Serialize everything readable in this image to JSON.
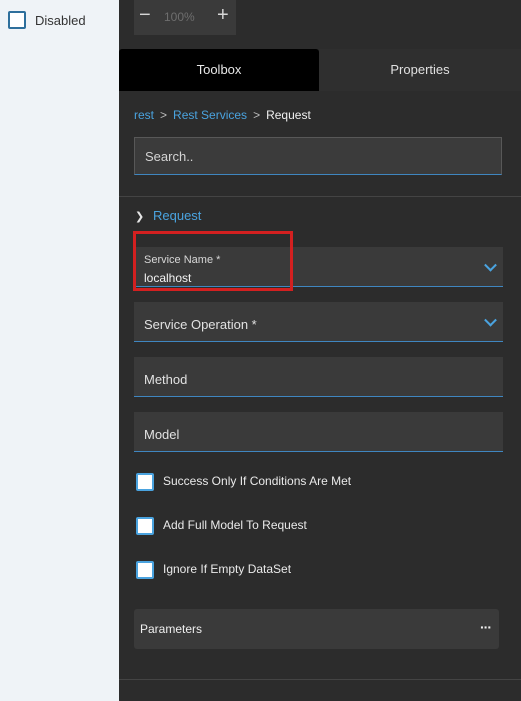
{
  "left_pane": {
    "disabled_label": "Disabled"
  },
  "zoom": {
    "minus": "−",
    "plus": "+",
    "level": "100%"
  },
  "tabs": [
    {
      "label": "Toolbox",
      "active": true
    },
    {
      "label": "Properties",
      "active": false
    }
  ],
  "breadcrumb": {
    "items": [
      "rest",
      "Rest Services",
      "Request"
    ],
    "separator": ">"
  },
  "search": {
    "placeholder": "Search.."
  },
  "section": {
    "title": "Request"
  },
  "fields": {
    "service_name": {
      "label": "Service Name *",
      "value": "localhost"
    },
    "service_operation": {
      "label": "Service Operation *"
    },
    "method": {
      "label": "Method"
    },
    "model": {
      "label": "Model"
    }
  },
  "checkboxes": [
    {
      "label": "Success Only If Conditions Are Met",
      "checked": false
    },
    {
      "label": "Add Full Model To Request",
      "checked": false
    },
    {
      "label": "Ignore If Empty DataSet",
      "checked": false
    }
  ],
  "parameters": {
    "label": "Parameters",
    "menu": "···"
  },
  "colors": {
    "accent": "#4aa3df",
    "highlight": "#d32020",
    "panel_bg": "#2c2c2c"
  }
}
